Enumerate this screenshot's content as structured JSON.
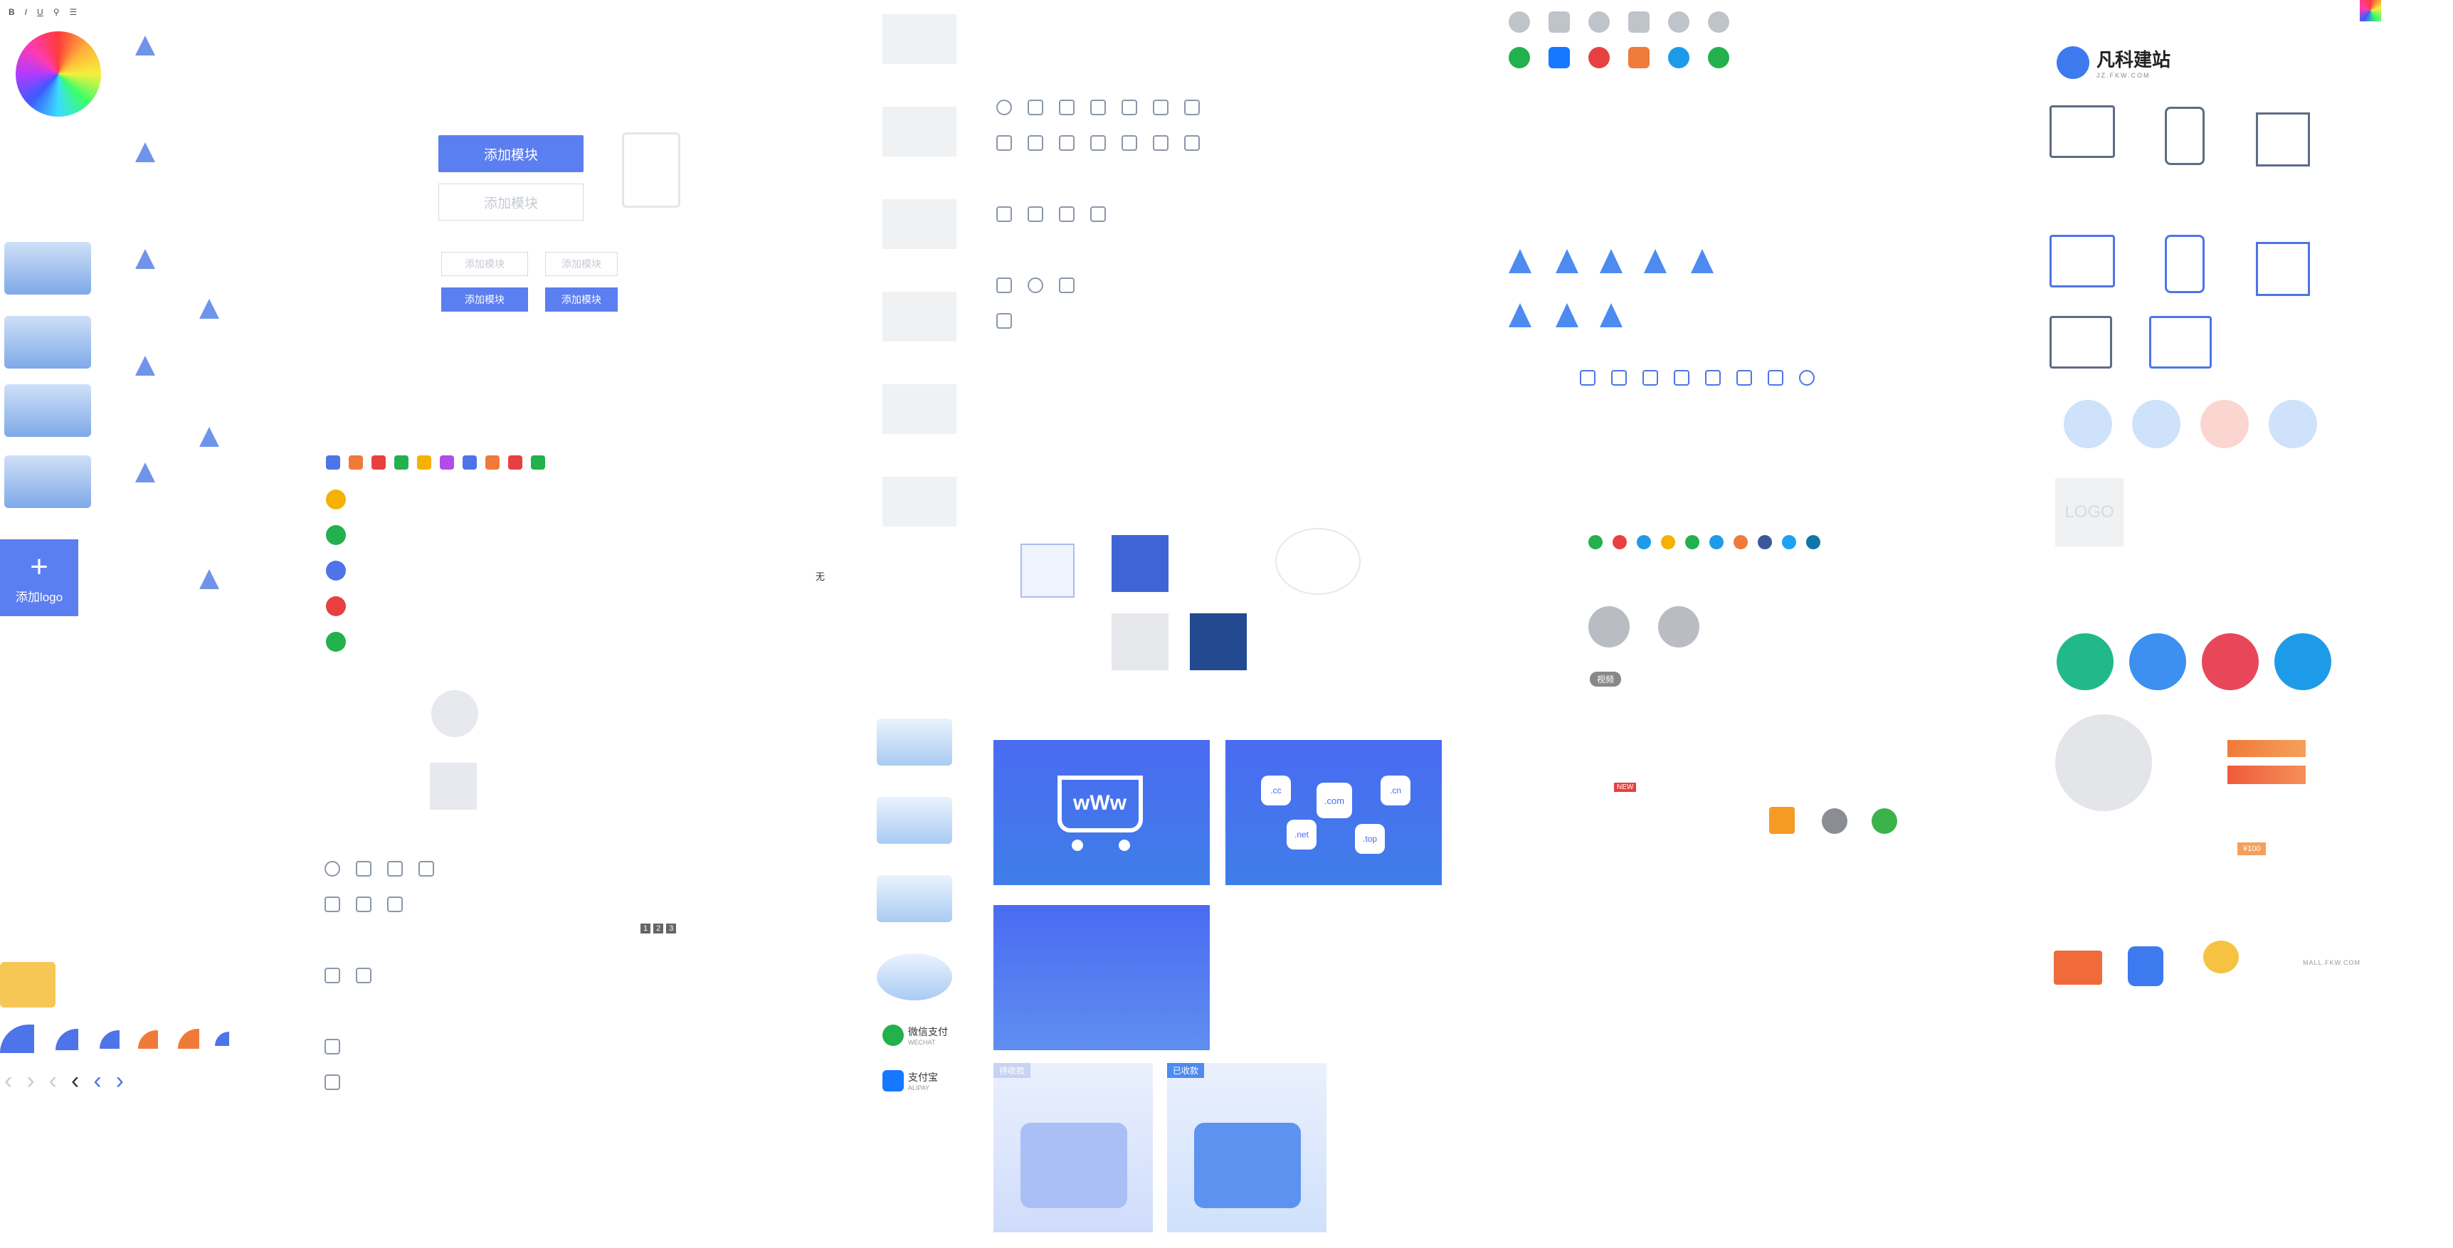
{
  "logo": {
    "name": "凡科建站",
    "sub": "JZ.FKW.COM"
  },
  "add_logo_label": "添加logo",
  "buttons": {
    "add_module": "添加模块",
    "add_module_disabled": "添加模块",
    "add_module_small": "添加模块",
    "add_module_small_disabled": "添加模块"
  },
  "domain_tiles": {
    "cart_text": "wWw",
    "domains": [
      ".cc",
      ".com",
      ".cn",
      ".net",
      ".top"
    ]
  },
  "status": {
    "pending": "待收款",
    "received": "已收款"
  },
  "payments": {
    "wechat": {
      "title": "微信支付",
      "sub": "WECHAT"
    },
    "alipay": {
      "title": "支付宝",
      "sub": "ALIPAY"
    }
  },
  "misc": {
    "video_label": "视频",
    "wu": "无",
    "new_badge": "NEW",
    "logo_placeholder": "LOGO",
    "price_tag": "¥100",
    "mall_text": "MALL.FKW.COM",
    "pager": [
      "1",
      "2",
      "3"
    ]
  },
  "colors": {
    "primary": "#5b7ef0",
    "icon_gray": "#8a96aa",
    "orange": "#f07a3a",
    "green": "#22b14c",
    "red": "#e84040",
    "yellow": "#f5b100"
  }
}
